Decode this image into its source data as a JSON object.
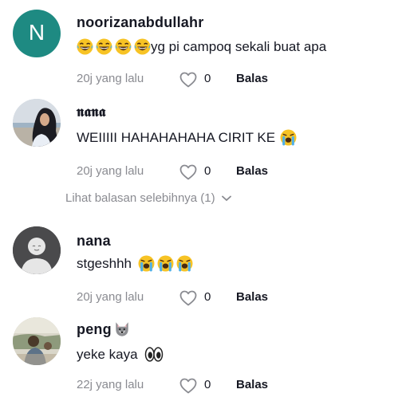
{
  "comments": [
    {
      "username": "noorizanabdullahr",
      "avatar_letter": "N",
      "avatar_color": "#1e8a82",
      "text": "yg pi campoq sekali buat apa",
      "emojis": [
        "laughing-tears-emoji",
        "laughing-tears-emoji",
        "laughing-tears-emoji",
        "laughing-tears-emoji"
      ],
      "time": "20j yang lalu",
      "likes": "0",
      "reply_label": "Balas"
    },
    {
      "username": "𝖓𝖆𝖓𝖆",
      "text": "WEIIIII HAHAHAHAHA CIRIT KE",
      "emojis": [
        "loudly-crying-emoji"
      ],
      "time": "20j yang lalu",
      "likes": "0",
      "reply_label": "Balas"
    },
    {
      "username": "nana",
      "text": "stgeshhh",
      "emojis": [
        "loudly-crying-emoji",
        "loudly-crying-emoji",
        "loudly-crying-emoji"
      ],
      "time": "20j yang lalu",
      "likes": "0",
      "reply_label": "Balas"
    },
    {
      "username": "peng",
      "username_emoji": "wolf-emoji",
      "text": "yeke kaya",
      "emojis": [
        "eyes-emoji"
      ],
      "time": "22j yang lalu",
      "likes": "0",
      "reply_label": "Balas"
    }
  ],
  "more_replies": "Lihat balasan selebihnya (1)"
}
